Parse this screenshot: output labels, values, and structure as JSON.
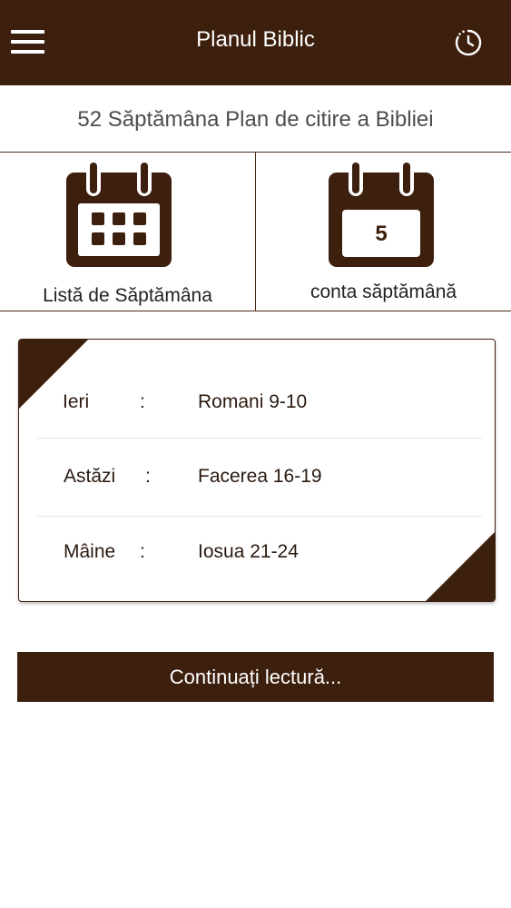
{
  "header": {
    "title": "Planul Biblic",
    "menu_icon": "hamburger-menu-icon",
    "history_icon": "clock-history-icon"
  },
  "subtitle": "52 Săptămâna Plan de citire a Bibliei",
  "tiles": [
    {
      "label": "Listă de Săptămâna",
      "icon": "calendar-grid-icon"
    },
    {
      "label": "conta săptămână",
      "icon": "calendar-number-icon",
      "number": "5"
    }
  ],
  "readings": [
    {
      "day": "Ieri",
      "separator": ":",
      "reference": "Romani  9-10"
    },
    {
      "day": "Astăzi",
      "separator": ":",
      "reference": "Facerea  16-19"
    },
    {
      "day": "Mâine",
      "separator": ":",
      "reference": "Iosua  21-24"
    }
  ],
  "continue_button": "Continuați lectură...",
  "colors": {
    "brand": "#3d1f0e",
    "background": "#ffffff"
  }
}
